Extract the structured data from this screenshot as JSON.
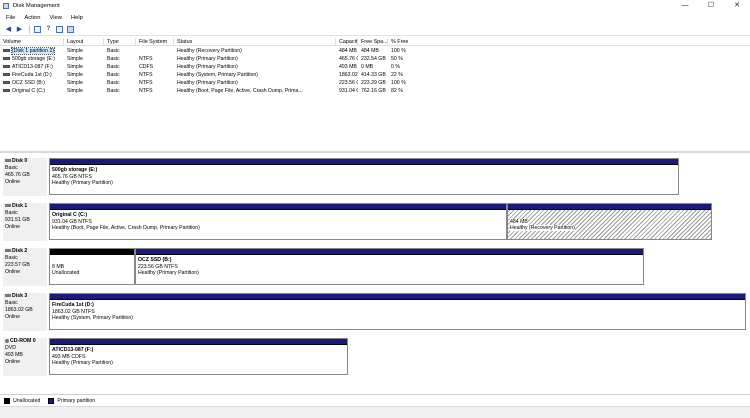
{
  "window": {
    "title": "Disk Management",
    "minimize": "—",
    "maximize": "☐",
    "close": "✕"
  },
  "menu": [
    "File",
    "Action",
    "View",
    "Help"
  ],
  "toolbar": {
    "icons": [
      "back-arrow-icon",
      "forward-arrow-icon",
      "list-view-icon",
      "help-icon",
      "properties-icon",
      "disk-icon"
    ]
  },
  "volume_table": {
    "columns": [
      "Volume",
      "Layout",
      "Type",
      "File System",
      "Status",
      "Capacity",
      "Free Spa...",
      "% Free"
    ],
    "rows": [
      {
        "volume": "(Disk 1 partition 2)",
        "layout": "Simple",
        "type": "Basic",
        "fs": "",
        "status": "Healthy (Recovery Partition)",
        "capacity": "484 MB",
        "free": "484 MB",
        "pct": "100 %",
        "selected": true
      },
      {
        "volume": "500gb storage (E:)",
        "layout": "Simple",
        "type": "Basic",
        "fs": "NTFS",
        "status": "Healthy (Primary Partition)",
        "capacity": "465.76 GB",
        "free": "232.54 GB",
        "pct": "50 %"
      },
      {
        "volume": "ATICD13-087 (F:)",
        "layout": "Simple",
        "type": "Basic",
        "fs": "CDFS",
        "status": "Healthy (Primary Partition)",
        "capacity": "493 MB",
        "free": "0 MB",
        "pct": "0 %"
      },
      {
        "volume": "FireCuda 1st (D:)",
        "layout": "Simple",
        "type": "Basic",
        "fs": "NTFS",
        "status": "Healthy (System, Primary Partition)",
        "capacity": "1863.02 GB",
        "free": "414.33 GB",
        "pct": "22 %"
      },
      {
        "volume": "OCZ SSD (B:)",
        "layout": "Simple",
        "type": "Basic",
        "fs": "NTFS",
        "status": "Healthy (Primary Partition)",
        "capacity": "223.56 GB",
        "free": "223.29 GB",
        "pct": "100 %"
      },
      {
        "volume": "Original C (C:)",
        "layout": "Simple",
        "type": "Basic",
        "fs": "NTFS",
        "status": "Healthy (Boot, Page File, Active, Crash Dump, Prima...",
        "capacity": "931.04 GB",
        "free": "762.16 GB",
        "pct": "82 %"
      }
    ]
  },
  "disks": [
    {
      "name": "Disk 0",
      "type": "Basic",
      "size": "465.76 GB",
      "state": "Online",
      "partitions": [
        {
          "name": "500gb storage (E:)",
          "detail": "465.76 GB NTFS",
          "status": "Healthy (Primary Partition)",
          "bar": "primary"
        }
      ]
    },
    {
      "name": "Disk 1",
      "type": "Basic",
      "size": "931.51 GB",
      "state": "Online",
      "partitions": [
        {
          "name": "Original C (C:)",
          "detail": "931.04 GB NTFS",
          "status": "Healthy (Boot, Page File, Active, Crash Dump, Primary Partition)",
          "bar": "primary"
        },
        {
          "name": "",
          "detail": "484 MB",
          "status": "Healthy (Recovery Partition)",
          "bar": "primary",
          "hatched": true
        }
      ]
    },
    {
      "name": "Disk 2",
      "type": "Basic",
      "size": "223.57 GB",
      "state": "Online",
      "partitions": [
        {
          "name": "",
          "detail": "8 MB",
          "status": "Unallocated",
          "bar": "unallocated"
        },
        {
          "name": "OCZ SSD (B:)",
          "detail": "223.56 GB NTFS",
          "status": "Healthy (Primary Partition)",
          "bar": "primary"
        }
      ]
    },
    {
      "name": "Disk 3",
      "type": "Basic",
      "size": "1863.02 GB",
      "state": "Online",
      "partitions": [
        {
          "name": "FireCuda 1st (D:)",
          "detail": "1863.02 GB NTFS",
          "status": "Healthy (System, Primary Partition)",
          "bar": "primary"
        }
      ]
    },
    {
      "name": "CD-ROM 0",
      "type": "DVD",
      "size": "493 MB",
      "state": "Online",
      "partitions": [
        {
          "name": "ATICD13-087 (F:)",
          "detail": "493 MB CDFS",
          "status": "Healthy (Primary Partition)",
          "bar": "primary"
        }
      ]
    }
  ],
  "legend": [
    {
      "label": "Unallocated",
      "color": "#000000"
    },
    {
      "label": "Primary partition",
      "color": "#1a1a7a"
    }
  ],
  "colors": {
    "primary_bar": "#1a1a7a",
    "unallocated_bar": "#000000",
    "selection": "#cce8ff"
  }
}
